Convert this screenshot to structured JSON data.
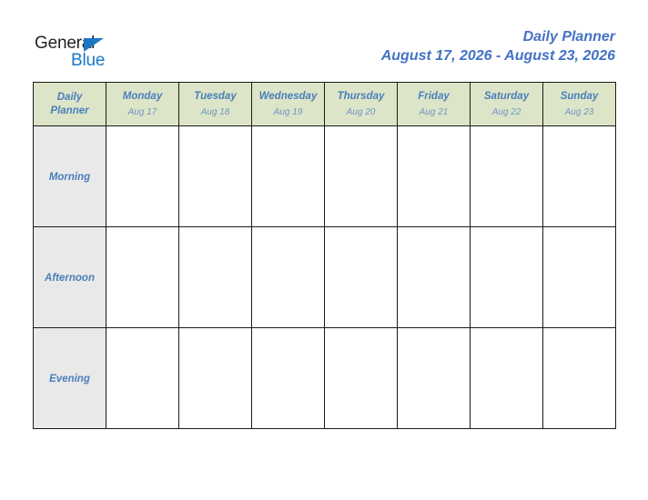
{
  "brand": {
    "name_part1": "General",
    "name_part2": "Blue",
    "triangle_color": "#1b77c4",
    "text_color": "#231f20"
  },
  "header": {
    "title": "Daily Planner",
    "date_range": "August 17, 2026 - August 23, 2026",
    "title_color": "#4472c4"
  },
  "planner": {
    "corner": {
      "line1": "Daily",
      "line2": "Planner"
    },
    "header_bg": "#dde5c8",
    "label_bg": "#e9e9e9",
    "accent_text": "#4a7ebb",
    "border_color": "#1a1a1a",
    "days": [
      {
        "name": "Monday",
        "date": "Aug 17"
      },
      {
        "name": "Tuesday",
        "date": "Aug 18"
      },
      {
        "name": "Wednesday",
        "date": "Aug 19"
      },
      {
        "name": "Thursday",
        "date": "Aug 20"
      },
      {
        "name": "Friday",
        "date": "Aug 21"
      },
      {
        "name": "Saturday",
        "date": "Aug 22"
      },
      {
        "name": "Sunday",
        "date": "Aug 23"
      }
    ],
    "periods": [
      {
        "label": "Morning",
        "entries": [
          "",
          "",
          "",
          "",
          "",
          "",
          ""
        ]
      },
      {
        "label": "Afternoon",
        "entries": [
          "",
          "",
          "",
          "",
          "",
          "",
          ""
        ]
      },
      {
        "label": "Evening",
        "entries": [
          "",
          "",
          "",
          "",
          "",
          "",
          ""
        ]
      }
    ]
  }
}
